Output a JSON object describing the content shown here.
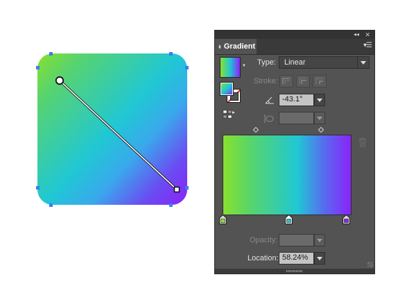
{
  "panel": {
    "tab_label": "Gradient",
    "collapse_icon": "double-chevron-icon",
    "close_icon": "close-icon",
    "menu_icon": "panel-menu-icon",
    "type": {
      "label": "Type:",
      "value": "Linear"
    },
    "stroke": {
      "label": "Stroke:",
      "enabled": false
    },
    "angle": {
      "value": "-43.1°"
    },
    "aspect_ratio": {
      "value": "",
      "enabled": false
    },
    "opacity": {
      "label": "Opacity:",
      "value": "",
      "enabled": false
    },
    "location": {
      "label": "Location:",
      "value": "58.24%"
    }
  },
  "gradient": {
    "stops": [
      {
        "color": "#88e12d",
        "position": 0
      },
      {
        "color": "#20c7d4",
        "position": 0.5824
      },
      {
        "color": "#8a23f8",
        "position": 1
      }
    ],
    "selected_stop": 1,
    "angle_degrees": -43.1
  },
  "colors": {
    "panel_bg": "#535353",
    "panel_dark": "#333333",
    "selection_blue": "#3d7cf4"
  }
}
